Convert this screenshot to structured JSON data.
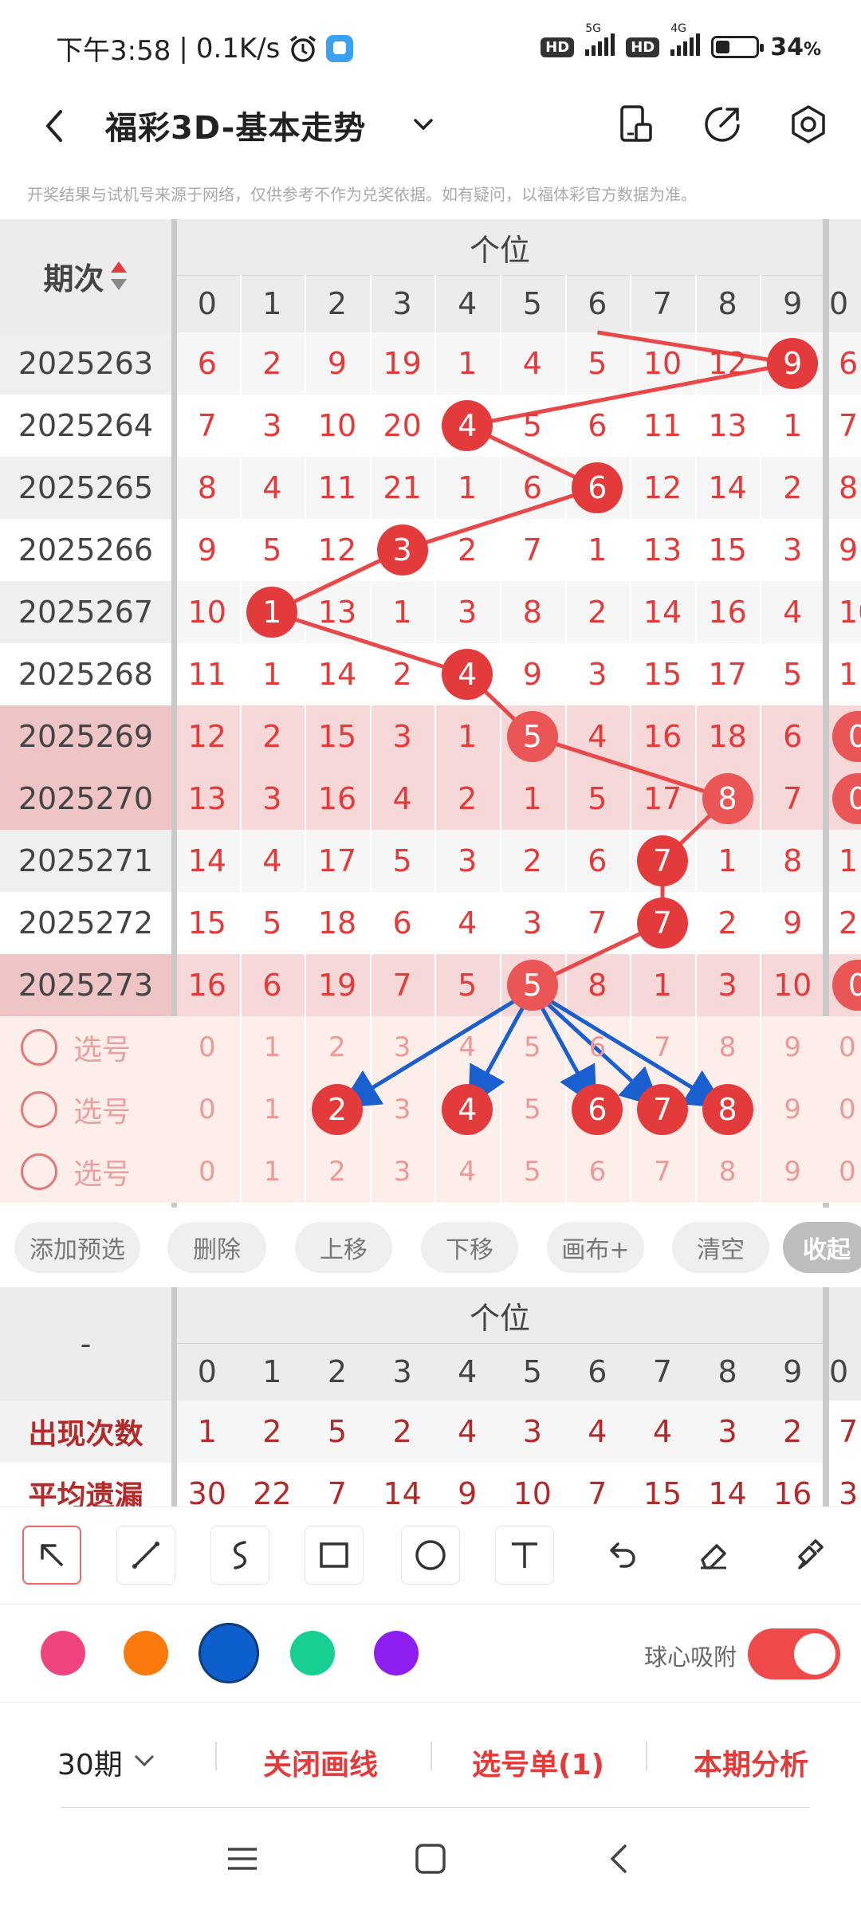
{
  "status_bar": {
    "time": "下午3:58",
    "speed": "0.1K/s",
    "battery": "34",
    "battery_unit": "%",
    "net1": "5G",
    "net2": "4G",
    "hd": "HD",
    "icons": [
      "alarm-icon",
      "app-notification-icon",
      "hd-icon",
      "signal-icon",
      "battery-icon"
    ]
  },
  "header": {
    "title": "福彩3D-基本走势",
    "icons": [
      "back-icon",
      "dropdown-chevron-icon",
      "screen-icon",
      "share-icon",
      "settings-icon"
    ]
  },
  "notice": "开奖结果与试机号来源于网络，仅供参考不作为兑奖依据。如有疑问，以福体彩官方数据为准。",
  "grid": {
    "period_header": "期次",
    "group_header": "个位",
    "digits": [
      "0",
      "1",
      "2",
      "3",
      "4",
      "5",
      "6",
      "7",
      "8",
      "9"
    ],
    "next_col_header": "0",
    "rows": [
      {
        "period": "2025263",
        "cells": [
          "6",
          "2",
          "9",
          "19",
          "1",
          "4",
          "5",
          "10",
          "12",
          "9"
        ],
        "hit": 9,
        "next": "6",
        "hl": false
      },
      {
        "period": "2025264",
        "cells": [
          "7",
          "3",
          "10",
          "20",
          "4",
          "5",
          "6",
          "11",
          "13",
          "1"
        ],
        "hit": 4,
        "next": "7",
        "hl": false
      },
      {
        "period": "2025265",
        "cells": [
          "8",
          "4",
          "11",
          "21",
          "1",
          "6",
          "6",
          "12",
          "14",
          "2"
        ],
        "hit": 6,
        "next": "8",
        "hl": false
      },
      {
        "period": "2025266",
        "cells": [
          "9",
          "5",
          "12",
          "3",
          "2",
          "7",
          "1",
          "13",
          "15",
          "3"
        ],
        "hit": 3,
        "next": "9",
        "hl": false
      },
      {
        "period": "2025267",
        "cells": [
          "10",
          "1",
          "13",
          "1",
          "3",
          "8",
          "2",
          "14",
          "16",
          "4"
        ],
        "hit": 1,
        "next": "10",
        "hl": false
      },
      {
        "period": "2025268",
        "cells": [
          "11",
          "1",
          "14",
          "2",
          "4",
          "9",
          "3",
          "15",
          "17",
          "5"
        ],
        "hit": 4,
        "next": "1",
        "hl": false
      },
      {
        "period": "2025269",
        "cells": [
          "12",
          "2",
          "15",
          "3",
          "1",
          "5",
          "4",
          "16",
          "18",
          "6"
        ],
        "hit": 5,
        "next": "0",
        "hl": true
      },
      {
        "period": "2025270",
        "cells": [
          "13",
          "3",
          "16",
          "4",
          "2",
          "1",
          "5",
          "17",
          "8",
          "7"
        ],
        "hit": 8,
        "next": "0",
        "hl": true
      },
      {
        "period": "2025271",
        "cells": [
          "14",
          "4",
          "17",
          "5",
          "3",
          "2",
          "6",
          "7",
          "1",
          "8"
        ],
        "hit": 7,
        "next": "1",
        "hl": false
      },
      {
        "period": "2025272",
        "cells": [
          "15",
          "5",
          "18",
          "6",
          "4",
          "3",
          "7",
          "7",
          "2",
          "9"
        ],
        "hit": 7,
        "next": "2",
        "hl": false
      },
      {
        "period": "2025273",
        "cells": [
          "16",
          "6",
          "19",
          "7",
          "5",
          "5",
          "8",
          "1",
          "3",
          "10"
        ],
        "hit": 5,
        "next": "0",
        "hl": true
      }
    ],
    "pick_label": "选号",
    "pick_rows": [
      {
        "selected": []
      },
      {
        "selected": [
          2,
          4,
          6,
          7,
          8
        ]
      },
      {
        "selected": []
      }
    ]
  },
  "actions": [
    "添加预选",
    "删除",
    "上移",
    "下移",
    "画布+",
    "清空"
  ],
  "collapse_label": "收起",
  "stats": {
    "corner": "-",
    "group_header": "个位",
    "digits": [
      "0",
      "1",
      "2",
      "3",
      "4",
      "5",
      "6",
      "7",
      "8",
      "9"
    ],
    "next_col_header": "0",
    "rows": [
      {
        "label": "出现次数",
        "values": [
          "1",
          "2",
          "5",
          "2",
          "4",
          "3",
          "4",
          "4",
          "3",
          "2"
        ],
        "next": "7"
      },
      {
        "label": "平均遗漏",
        "values": [
          "30",
          "22",
          "7",
          "14",
          "9",
          "10",
          "7",
          "15",
          "14",
          "16"
        ],
        "next": "3"
      }
    ]
  },
  "tools": [
    "arrow-tool-icon",
    "line-tool-icon",
    "curve-tool-icon",
    "rect-tool-icon",
    "circle-tool-icon",
    "text-tool-icon",
    "undo-icon",
    "eraser-icon",
    "clear-brush-icon"
  ],
  "palette": {
    "colors": [
      "#f0447e",
      "#fb7a0b",
      "#0c5fcc",
      "#17cf93",
      "#8e1ff0"
    ],
    "selected": 2
  },
  "snap_label": "球心吸附",
  "snap_on": true,
  "bottom": {
    "periods": "30期",
    "close_lines": "关闭画线",
    "pick_list": "选号单(1)",
    "analysis": "本期分析"
  },
  "colors": {
    "accent": "#e33a3a",
    "arrow": "#1a5fd0",
    "highlight_row": "#f7d6d6"
  }
}
